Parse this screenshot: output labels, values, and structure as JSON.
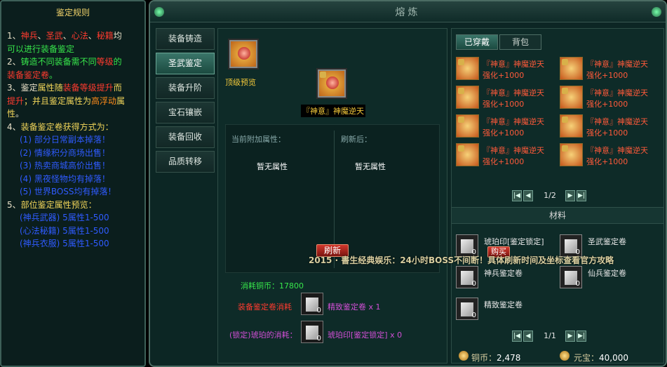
{
  "rules": {
    "title": "鉴定规则",
    "lines": [
      [
        {
          "t": "1、",
          "c": "white"
        },
        {
          "t": "神兵",
          "c": "red"
        },
        {
          "t": "、",
          "c": "white"
        },
        {
          "t": "圣武",
          "c": "red"
        },
        {
          "t": "、",
          "c": "white"
        },
        {
          "t": "心法",
          "c": "red"
        },
        {
          "t": "、",
          "c": "white"
        },
        {
          "t": "秘籍",
          "c": "red"
        },
        {
          "t": "均",
          "c": "white"
        }
      ],
      [
        {
          "t": "可以进行装备鉴定",
          "c": "green"
        }
      ],
      [
        {
          "t": "2、",
          "c": "white"
        },
        {
          "t": "铸造不同装备需不同",
          "c": "green"
        },
        {
          "t": "等级",
          "c": "red"
        },
        {
          "t": "的",
          "c": "green"
        }
      ],
      [
        {
          "t": "装备鉴定卷",
          "c": "red"
        },
        {
          "t": "。",
          "c": "green"
        }
      ],
      [
        {
          "t": "3、",
          "c": "white"
        },
        {
          "t": "鉴定",
          "c": "white"
        },
        {
          "t": "属性随",
          "c": "yellow"
        },
        {
          "t": "装备等级提升",
          "c": "red"
        },
        {
          "t": "而",
          "c": "yellow"
        }
      ],
      [
        {
          "t": "提升",
          "c": "red"
        },
        {
          "t": "；并且鉴定属性为",
          "c": "yellow"
        },
        {
          "t": "高浮动",
          "c": "orange"
        },
        {
          "t": "属",
          "c": "yellow"
        }
      ],
      [
        {
          "t": "性",
          "c": "yellow"
        },
        {
          "t": "。",
          "c": "white"
        }
      ],
      [
        {
          "t": "4、",
          "c": "white"
        },
        {
          "t": "装备鉴定卷获得方式为：",
          "c": "yellow"
        }
      ],
      [
        {
          "t": "(1) 部分日常副本掉落！",
          "c": "blue",
          "ind": true
        }
      ],
      [
        {
          "t": "(2) 情缘积分商场出售！",
          "c": "blue",
          "ind": true
        }
      ],
      [
        {
          "t": "(3) 热卖商城高价出售！",
          "c": "blue",
          "ind": true
        }
      ],
      [
        {
          "t": "(4) 黑夜怪物均有掉落！",
          "c": "blue",
          "ind": true
        }
      ],
      [
        {
          "t": "(5) 世界BOSS均有掉落！",
          "c": "blue",
          "ind": true
        }
      ],
      [
        {
          "t": "5、",
          "c": "white"
        },
        {
          "t": "部位鉴定属性预览：",
          "c": "yellow"
        }
      ],
      [
        {
          "t": "(神兵武器) 5属性1-500",
          "c": "blue",
          "ind": true
        }
      ],
      [
        {
          "t": "(心法秘籍) 5属性1-500",
          "c": "blue",
          "ind": true
        }
      ],
      [
        {
          "t": "(神兵衣服) 5属性1-500",
          "c": "blue",
          "ind": true
        }
      ]
    ]
  },
  "window": {
    "title": "熔炼",
    "left_tabs": [
      "装备铸造",
      "圣武鉴定",
      "装备升阶",
      "宝石镶嵌",
      "装备回收",
      "品质转移"
    ],
    "active_tab": 1
  },
  "center": {
    "preview_label": "顶级预览",
    "item_name": "『神意』神魔逆天",
    "current_attr_header": "当前附加属性：",
    "refresh_after_header": "刷新后：",
    "current_attr_value": "暂无属性",
    "refresh_attr_value": "暂无属性",
    "refresh_button": "刷新",
    "cost_copper_label": "消耗铜币：17800",
    "cost_scroll_label": "装备鉴定卷消耗",
    "cost_scroll_item": "精致鉴定卷 x 1",
    "cost_scroll_count": "0",
    "cost_amber_label": "(锁定)琥珀的消耗：",
    "cost_amber_item": "琥珀印[鉴定锁定] x 0",
    "cost_amber_count": "0"
  },
  "right": {
    "tabs": [
      "已穿戴",
      "背包"
    ],
    "active_tab": 0,
    "equipped": [
      {
        "name": "『神意』神魔逆天",
        "sub": "强化+1000"
      },
      {
        "name": "『神意』神魔逆天",
        "sub": "强化+1000"
      },
      {
        "name": "『神意』神魔逆天",
        "sub": "强化+1000"
      },
      {
        "name": "『神意』神魔逆天",
        "sub": "强化+1000"
      },
      {
        "name": "『神意』神魔逆天",
        "sub": "强化+1000"
      },
      {
        "name": "『神意』神魔逆天",
        "sub": "强化+1000"
      },
      {
        "name": "『神意』神魔逆天",
        "sub": "强化+1000"
      },
      {
        "name": "『神意』神魔逆天",
        "sub": "强化+1000"
      }
    ],
    "equip_page": "1/2",
    "materials_title": "材料",
    "materials": [
      {
        "name": "琥珀印[鉴定锁定]",
        "count": "0"
      },
      {
        "name": "圣武鉴定卷",
        "count": "0"
      },
      {
        "name": "神兵鉴定卷",
        "count": "0"
      },
      {
        "name": "仙兵鉴定卷",
        "count": "0"
      },
      {
        "name": "精致鉴定卷",
        "count": "0"
      }
    ],
    "buy_label": "购买",
    "material_page": "1/1",
    "copper_label": "铜币：",
    "copper_value": "2,478",
    "yuanbao_label": "元宝：",
    "yuanbao_value": "40,000"
  },
  "marquee": "2015 · 書生经典娱乐：24小时BOSS不间断！具体刷新时间及坐标查看官方攻略",
  "colors": {
    "red": "#ff3b2f",
    "green": "#37e64b",
    "yellow": "#f3d75a",
    "orange": "#ff8c1a",
    "blue": "#2f5bff",
    "white": "#e8e0c8"
  }
}
